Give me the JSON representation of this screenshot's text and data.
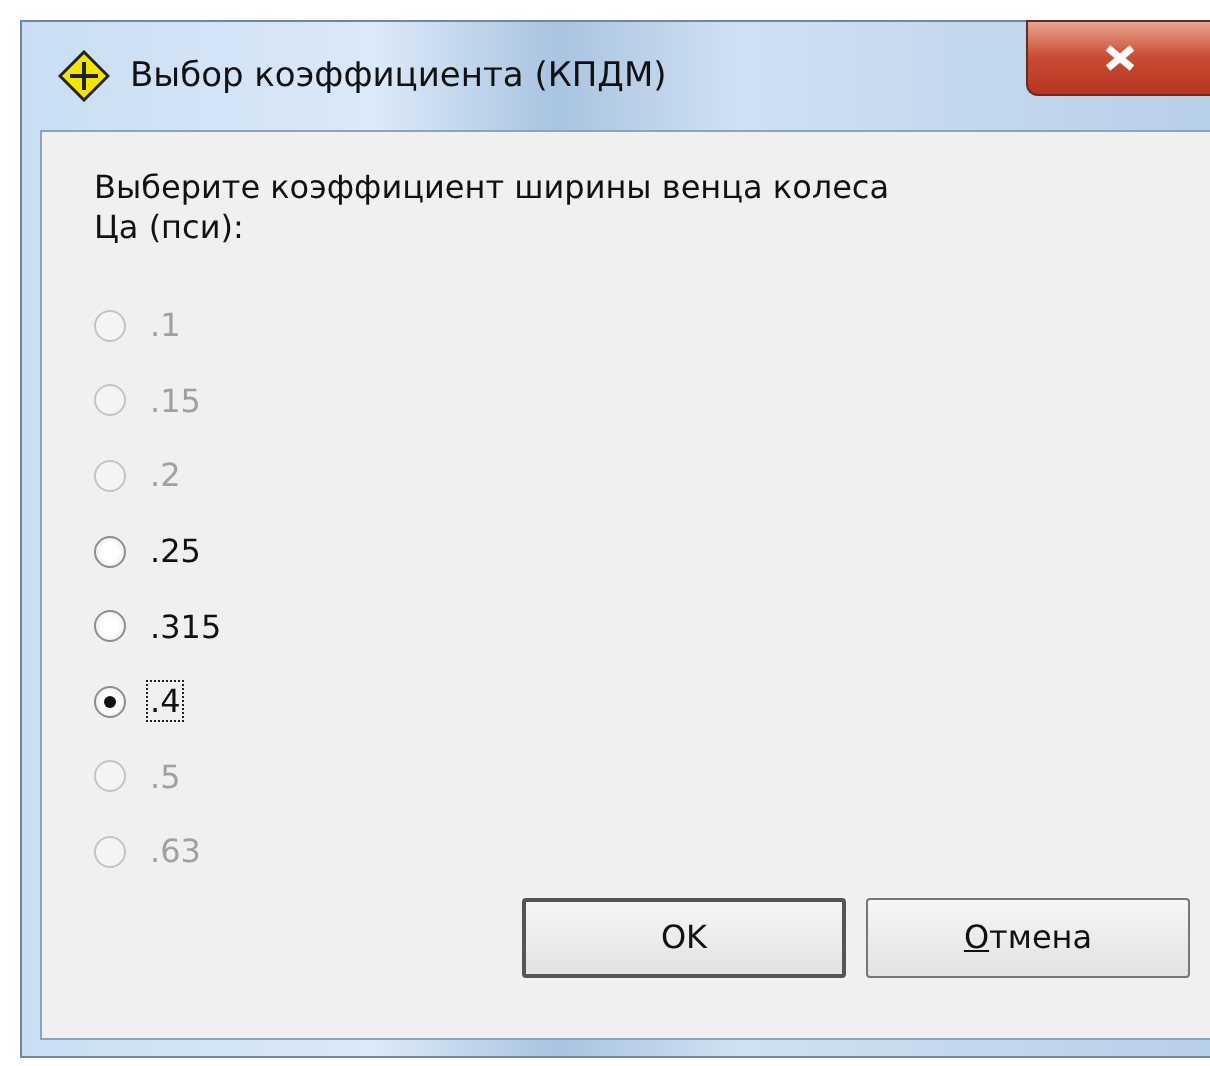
{
  "window": {
    "title": "Выбор коэффициента (КПДМ)"
  },
  "prompt": {
    "lines": [
      "Выберите коэффициент ширины венца колеса",
      "Ца (пси):"
    ]
  },
  "options": [
    {
      "label": ".1",
      "selected": false,
      "disabled": true,
      "focused": false
    },
    {
      "label": ".15",
      "selected": false,
      "disabled": true,
      "focused": false
    },
    {
      "label": ".2",
      "selected": false,
      "disabled": true,
      "focused": false
    },
    {
      "label": ".25",
      "selected": false,
      "disabled": false,
      "focused": false
    },
    {
      "label": ".315",
      "selected": false,
      "disabled": false,
      "focused": false
    },
    {
      "label": ".4",
      "selected": true,
      "disabled": false,
      "focused": true
    },
    {
      "label": ".5",
      "selected": false,
      "disabled": true,
      "focused": false
    },
    {
      "label": ".63",
      "selected": false,
      "disabled": true,
      "focused": false
    }
  ],
  "buttons": [
    {
      "label": "OK",
      "default": true
    },
    {
      "label": "Отмена",
      "default": false
    }
  ]
}
